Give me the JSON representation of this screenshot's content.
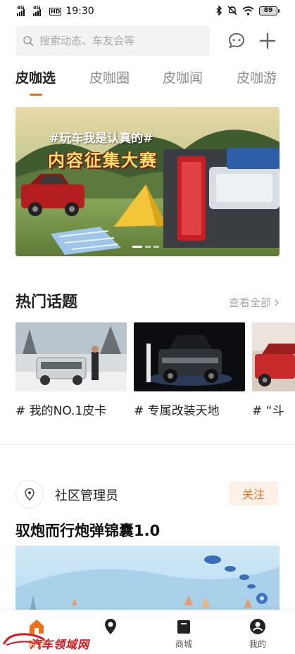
{
  "status_bar": {
    "sim1": "4G",
    "sim2": "4G",
    "hd": "HD",
    "time": "19:30",
    "battery": "89"
  },
  "search": {
    "placeholder": "搜索动态、车友会等"
  },
  "tabs": [
    {
      "label": "皮咖选",
      "active": true
    },
    {
      "label": "皮咖圈",
      "active": false
    },
    {
      "label": "皮咖闻",
      "active": false
    },
    {
      "label": "皮咖游",
      "active": false
    }
  ],
  "banner": {
    "line1": "#玩车我是认真的#",
    "line2": "内容征集大赛"
  },
  "hot_topics": {
    "title": "热门话题",
    "view_all": "查看全部",
    "items": [
      {
        "label": "# 我的NO.1皮卡"
      },
      {
        "label": "# 专属改装天地"
      },
      {
        "label": "# “斗"
      }
    ]
  },
  "post": {
    "author": "社区管理员",
    "follow_label": "关注",
    "title": "驭炮而行炮弹锦囊1.0"
  },
  "bottom_nav": [
    {
      "label": "首页",
      "active": true
    },
    {
      "label": "",
      "active": false
    },
    {
      "label": "商城",
      "active": false
    },
    {
      "label": "我的",
      "active": false
    }
  ],
  "watermark": {
    "text": "汽车领域网"
  },
  "colors": {
    "accent": "#f0711d",
    "follow_bg": "#fdf0e7",
    "watermark": "#d8141c"
  }
}
